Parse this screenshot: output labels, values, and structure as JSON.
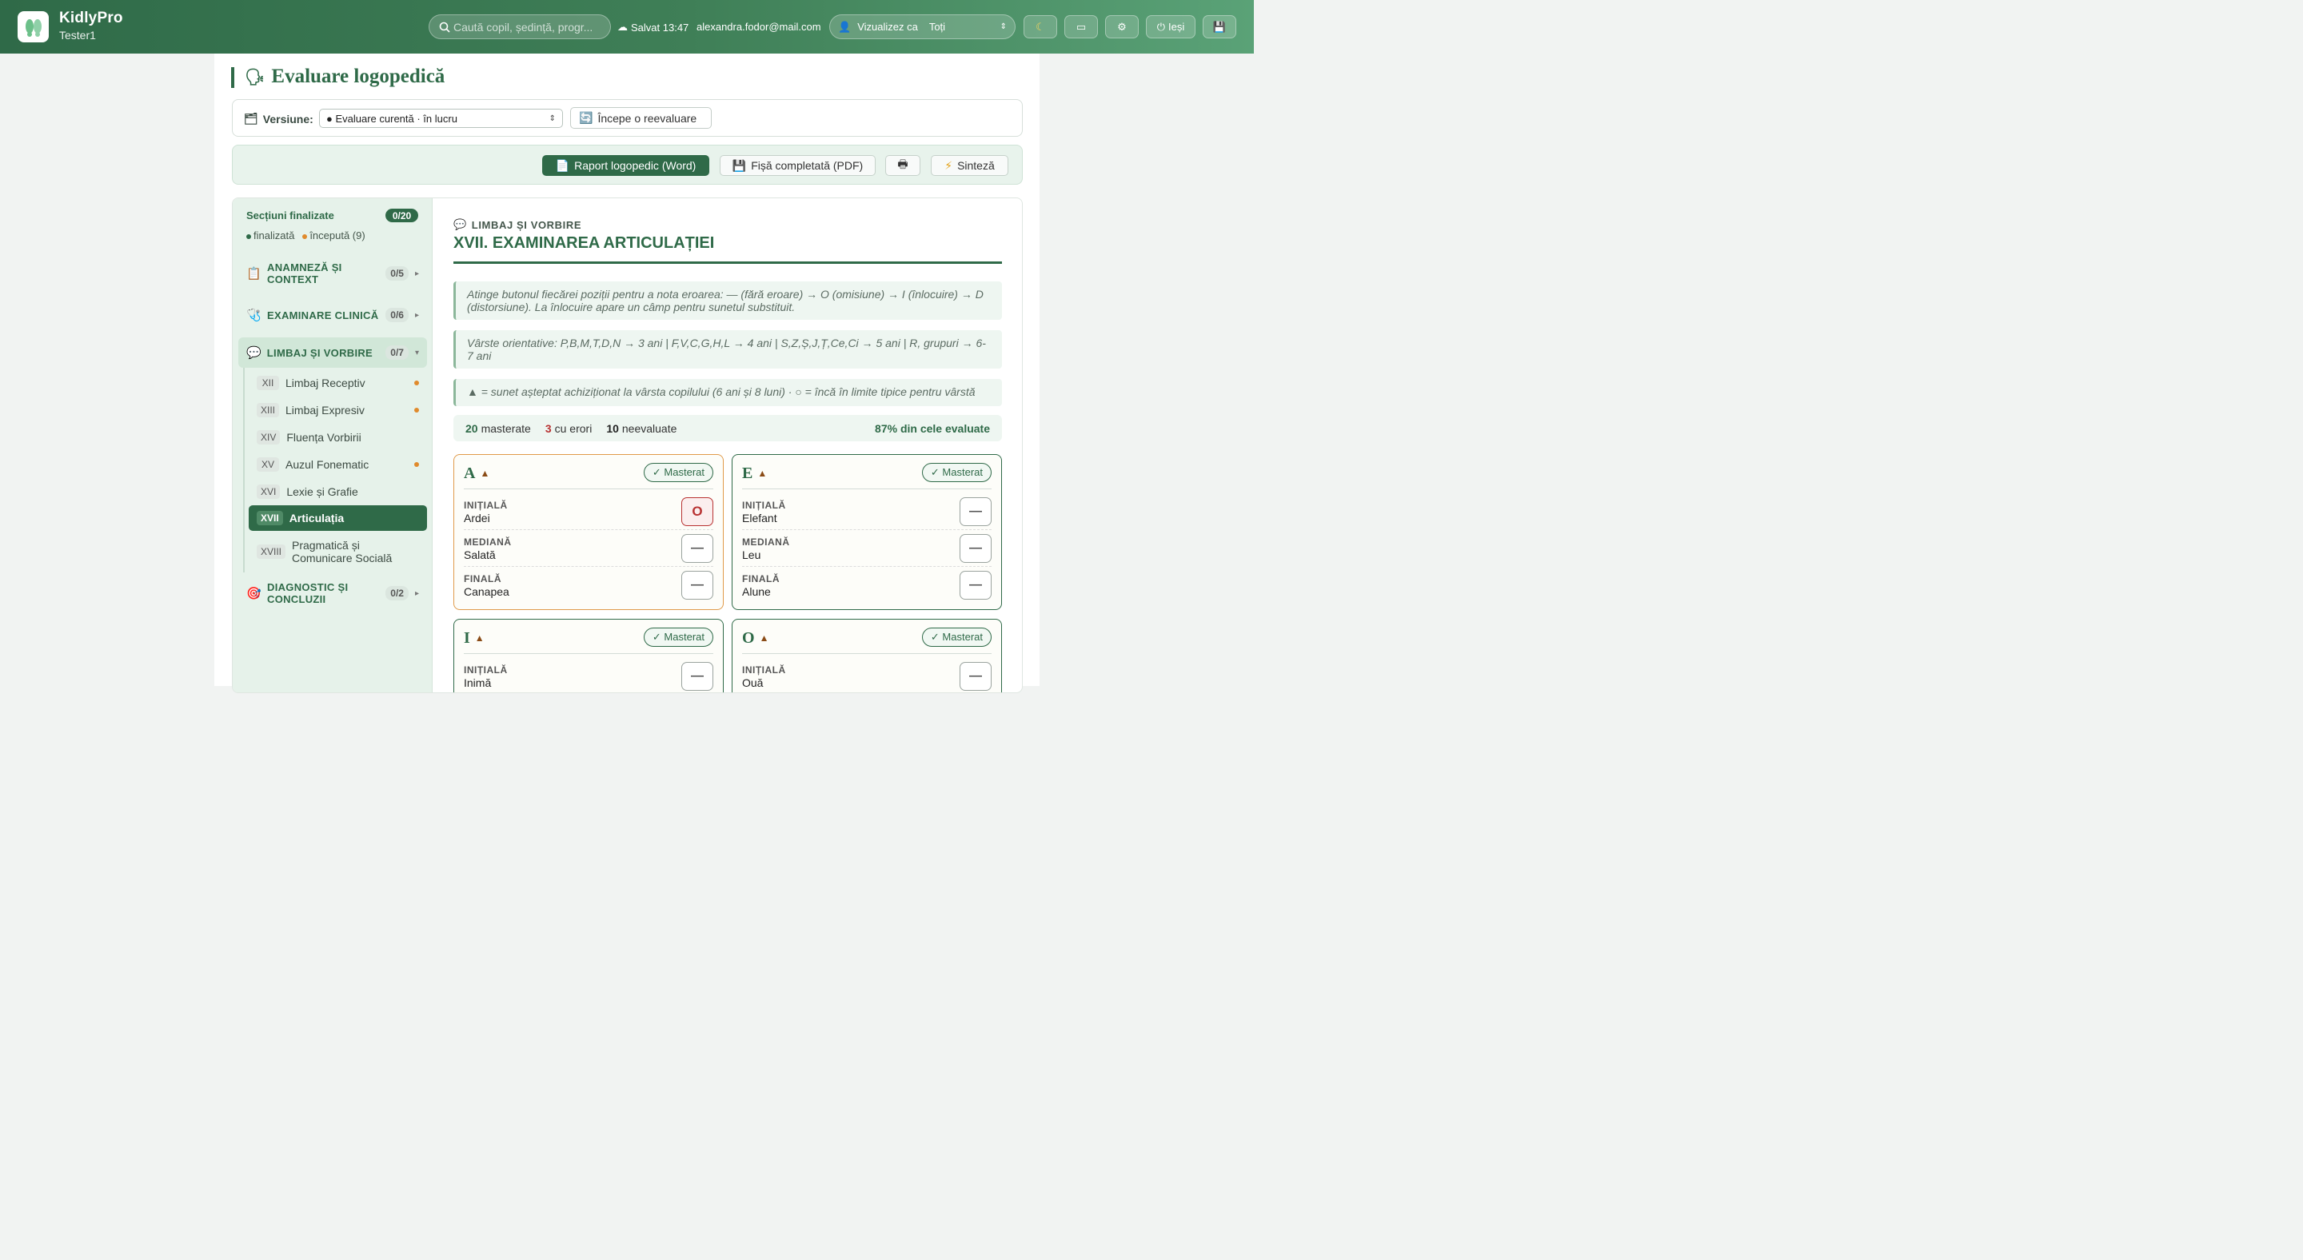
{
  "app": {
    "name": "KidlyPro",
    "user": "Tester1"
  },
  "header": {
    "search_placeholder": "Caută copil, ședință, progr...",
    "saved": "Salvat 13:47",
    "email": "alexandra.fodor@mail.com",
    "view_as_label": "Vizualizez ca",
    "view_as_value": "Toți",
    "logout": "Ieși"
  },
  "page": {
    "title": "Evaluare logopedică"
  },
  "version": {
    "label": "Versiune:",
    "selected": "● Evaluare curentă · în lucru",
    "reeval": "Începe o reevaluare"
  },
  "actions": {
    "report_word": "Raport logopedic (Word)",
    "sheet_pdf": "Fișă completată (PDF)",
    "synthesis": "Sinteză"
  },
  "sidebar": {
    "heading": "Secțiuni finalizate",
    "badge": "0/20",
    "legend_done": "finalizată",
    "legend_started": "începută (9)",
    "sections": [
      {
        "label": "ANAMNEZĂ ȘI CONTEXT",
        "count": "0/5"
      },
      {
        "label": "EXAMINARE CLINICĂ",
        "count": "0/6"
      },
      {
        "label": "LIMBAJ ȘI VORBIRE",
        "count": "0/7"
      },
      {
        "label": "DIAGNOSTIC ȘI CONCLUZII",
        "count": "0/2"
      }
    ],
    "subs": [
      {
        "num": "XII",
        "label": "Limbaj Receptiv"
      },
      {
        "num": "XIII",
        "label": "Limbaj Expresiv"
      },
      {
        "num": "XIV",
        "label": "Fluența Vorbirii"
      },
      {
        "num": "XV",
        "label": "Auzul Fonematic"
      },
      {
        "num": "XVI",
        "label": "Lexie și Grafie"
      },
      {
        "num": "XVII",
        "label": "Articulația"
      },
      {
        "num": "XVIII",
        "label": "Pragmatică și Comunicare Socială"
      }
    ]
  },
  "content": {
    "category": "LIMBAJ ȘI VORBIRE",
    "title": "XVII. EXAMINAREA ARTICULAȚIEI",
    "notes": [
      "Atinge butonul fiecărei poziții pentru a nota eroarea: — (fără eroare) → O (omisiune) → I (înlocuire) → D (distorsiune). La înlocuire apare un câmp pentru sunetul substituit.",
      "Vârste orientative: P,B,M,T,D,N → 3 ani | F,V,C,G,H,L → 4 ani | S,Z,Ș,J,Ț,Ce,Ci → 5 ani | R, grupuri → 6-7 ani",
      "▲ = sunet așteptat achiziționat la vârsta copilului (6 ani și 8 luni) · ○ = încă în limite tipice pentru vârstă"
    ],
    "stats": {
      "mastered_n": "20",
      "mastered_l": "masterate",
      "errors_n": "3",
      "errors_l": "cu erori",
      "unevaluated_n": "10",
      "unevaluated_l": "neevaluate",
      "pct": "87% din cele evaluate"
    },
    "mastered_label": "✓ Masterat",
    "pos_initial": "INIȚIALĂ",
    "pos_medial": "MEDIANĂ",
    "pos_final": "FINALĂ",
    "cards": [
      {
        "letter": "A",
        "initial": "Ardei",
        "medial": "Salată",
        "final": "Canapea",
        "m_initial": "O",
        "m_medial": "—",
        "m_final": "—"
      },
      {
        "letter": "E",
        "initial": "Elefant",
        "medial": "Leu",
        "final": "Alune",
        "m_initial": "—",
        "m_medial": "—",
        "m_final": "—"
      },
      {
        "letter": "I",
        "initial": "Inimă",
        "m_initial": "—"
      },
      {
        "letter": "O",
        "initial": "Ouă",
        "m_initial": "—"
      }
    ]
  }
}
